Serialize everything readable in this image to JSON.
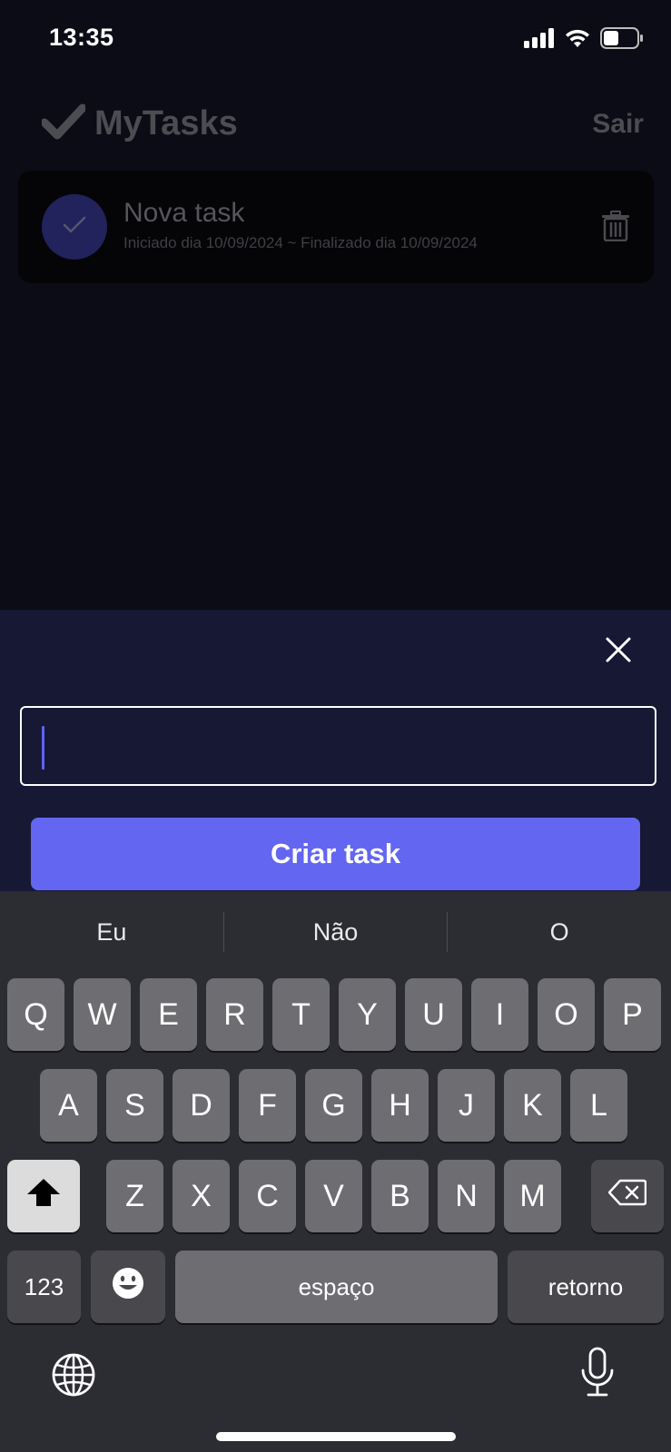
{
  "status_bar": {
    "time": "13:35"
  },
  "header": {
    "app_title": "MyTasks",
    "logout_label": "Sair"
  },
  "tasks": [
    {
      "title": "Nova task",
      "dates": "Iniciado dia 10/09/2024 ~ Finalizado dia 10/09/2024",
      "completed": true
    }
  ],
  "sheet": {
    "input_value": "",
    "create_button_label": "Criar task"
  },
  "keyboard": {
    "suggestions": [
      "Eu",
      "Não",
      "O"
    ],
    "row1": [
      "Q",
      "W",
      "E",
      "R",
      "T",
      "Y",
      "U",
      "I",
      "O",
      "P"
    ],
    "row2": [
      "A",
      "S",
      "D",
      "F",
      "G",
      "H",
      "J",
      "K",
      "L"
    ],
    "row3": [
      "Z",
      "X",
      "C",
      "V",
      "B",
      "N",
      "M"
    ],
    "numbers_label": "123",
    "space_label": "espaço",
    "return_label": "retorno"
  },
  "colors": {
    "accent": "#6366f1",
    "sheet_background": "#171834",
    "keyboard_background": "#2c2c33"
  }
}
